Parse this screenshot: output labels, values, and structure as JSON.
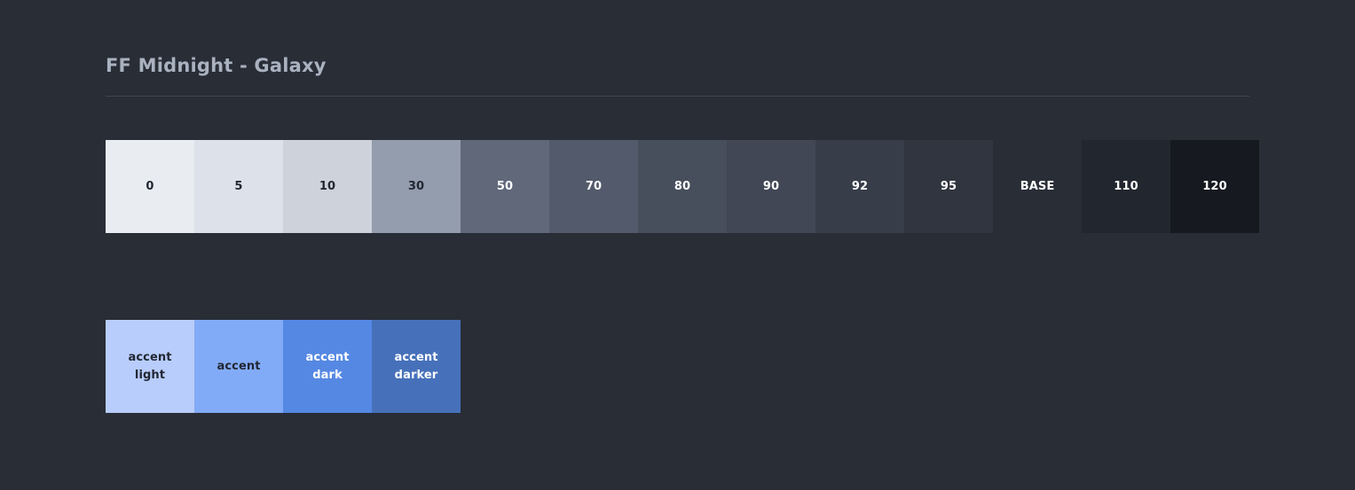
{
  "palette": {
    "title": "FF Midnight - Galaxy",
    "background_color": "#282d36",
    "title_color": "#aab2c0",
    "rule_color": "#414754"
  },
  "neutral_ramp": {
    "name": "neutral-scale",
    "swatches": [
      {
        "label": "0",
        "color": "#e9ecf1",
        "text_color": "#222733"
      },
      {
        "label": "5",
        "color": "#dde1e9",
        "text_color": "#222733"
      },
      {
        "label": "10",
        "color": "#ced3db",
        "text_color": "#222733"
      },
      {
        "label": "30",
        "color": "#949dad",
        "text_color": "#222733"
      },
      {
        "label": "50",
        "color": "#60687a",
        "text_color": "#ffffff"
      },
      {
        "label": "70",
        "color": "#525a6b",
        "text_color": "#ffffff"
      },
      {
        "label": "80",
        "color": "#474e5c",
        "text_color": "#ffffff"
      },
      {
        "label": "90",
        "color": "#414754",
        "text_color": "#ffffff"
      },
      {
        "label": "92",
        "color": "#373d49",
        "text_color": "#ffffff"
      },
      {
        "label": "95",
        "color": "#30353f",
        "text_color": "#ffffff"
      },
      {
        "label": "BASE",
        "color": "#282d36",
        "text_color": "#ffffff"
      },
      {
        "label": "110",
        "color": "#22262e",
        "text_color": "#ffffff"
      },
      {
        "label": "120",
        "color": "#16191f",
        "text_color": "#ffffff"
      }
    ]
  },
  "accent_ramp": {
    "name": "accent-scale",
    "swatches": [
      {
        "label": "accent\nlight",
        "color": "#b8cdfb",
        "text_color": "#222733"
      },
      {
        "label": "accent",
        "color": "#82abf7",
        "text_color": "#222733"
      },
      {
        "label": "accent\ndark",
        "color": "#5588e3",
        "text_color": "#ffffff"
      },
      {
        "label": "accent\ndarker",
        "color": "#4671ba",
        "text_color": "#ffffff"
      }
    ]
  }
}
